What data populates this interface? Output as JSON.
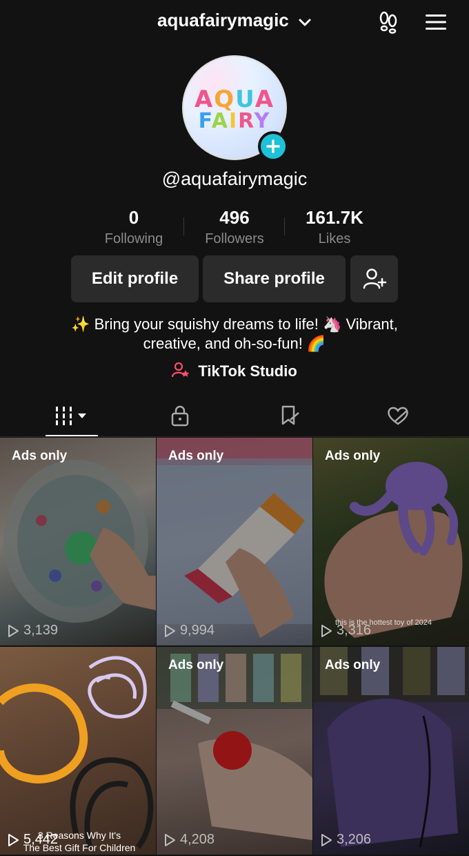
{
  "header": {
    "title": "aquafairymagic"
  },
  "avatar": {
    "logo_line1": "AQUA",
    "logo_line2": "FAIRY"
  },
  "profile": {
    "handle": "@aquafairymagic",
    "bio_line1": "✨ Bring your squishy dreams to life! 🦄 Vibrant,",
    "bio_line2": "creative, and oh-so-fun! 🌈",
    "studio_link": "TikTok Studio"
  },
  "stats": [
    {
      "value": "0",
      "label": "Following"
    },
    {
      "value": "496",
      "label": "Followers"
    },
    {
      "value": "161.7K",
      "label": "Likes"
    }
  ],
  "buttons": {
    "edit": "Edit profile",
    "share": "Share profile"
  },
  "tabs": [
    {
      "icon": "grid-icon"
    },
    {
      "icon": "lock-icon"
    },
    {
      "icon": "bookmark-icon"
    },
    {
      "icon": "liked-heart-icon"
    }
  ],
  "videos": [
    {
      "badge": "Ads only",
      "views": "3,139"
    },
    {
      "badge": "Ads only",
      "views": "9,994"
    },
    {
      "badge": "Ads only",
      "views": "3,316",
      "caption": "this is the hottest toy of 2024"
    },
    {
      "badge": "",
      "views": "5,442",
      "caption_line1": "3 Reasons Why It's",
      "caption_line2": "The Best Gift For Children"
    },
    {
      "badge": "Ads only",
      "views": "4,208"
    },
    {
      "badge": "Ads only",
      "views": "3,206"
    }
  ],
  "colors": {
    "background": "#121212",
    "button_bg": "#2b2b2b",
    "accent": "#1dc1d8",
    "muted": "#8a8a8a"
  }
}
